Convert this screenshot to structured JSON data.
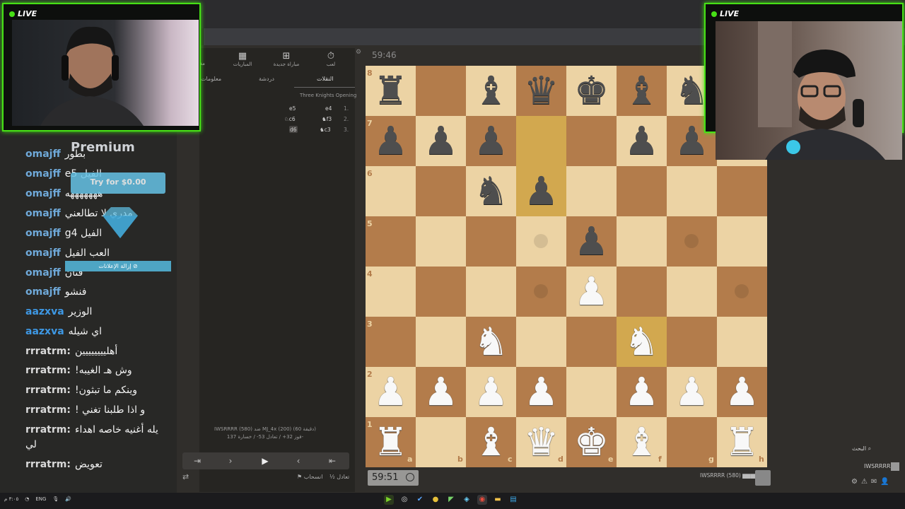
{
  "overlay": {
    "live_label": "LIVE",
    "premium_title": "Premium",
    "try_button": "Try for $0.00",
    "remove_ads": "إزالة الإعلانات ⊘"
  },
  "chat": [
    {
      "user": "omajff",
      "msg": "بطور",
      "color": "#6fa9d9"
    },
    {
      "user": "omajff",
      "msg": "e5 الفيل",
      "color": "#6fa9d9"
    },
    {
      "user": "omajff",
      "msg": "هههههههه",
      "color": "#6fa9d9"
    },
    {
      "user": "omajff",
      "msg": "مدري لا تطالعني",
      "color": "#6fa9d9"
    },
    {
      "user": "omajff",
      "msg": "g4 الفيل",
      "color": "#6fa9d9"
    },
    {
      "user": "omajff",
      "msg": "العب الفيل",
      "color": "#6fa9d9"
    },
    {
      "user": "omajff",
      "msg": "فنان",
      "color": "#6fa9d9"
    },
    {
      "user": "omajff",
      "msg": "فنشو",
      "color": "#6fa9d9"
    },
    {
      "user": "aazxva",
      "msg": "الوزير",
      "color": "#3e98e4"
    },
    {
      "user": "aazxva",
      "msg": "اي شيله",
      "color": "#3e98e4"
    },
    {
      "user": "rrratrm:",
      "msg": "أهليييييييين",
      "color": "#d9d9d9"
    },
    {
      "user": "rrratrm:",
      "msg": "!وش هـ الغيبه",
      "color": "#d9d9d9"
    },
    {
      "user": "rrratrm:",
      "msg": "!وينكم ما تبثون",
      "color": "#d9d9d9"
    },
    {
      "user": "rrratrm:",
      "msg": "! و اذا طلبنا تغني",
      "color": "#d9d9d9"
    },
    {
      "user": "rrratrm:",
      "msg": "يله أغنيه خاصه اهداء",
      "color": "#d9d9d9"
    },
    {
      "user": "",
      "msg": "لي",
      "color": "#d9d9d9"
    },
    {
      "user": "rrratrm:",
      "msg": "تعويض",
      "color": "#d9d9d9"
    }
  ],
  "panel": {
    "tabs": [
      "لعب",
      "مباراة جديدة",
      "المباريات",
      "مغلوب"
    ],
    "subtabs": [
      "النقلات",
      "دردشة",
      "معلومات"
    ],
    "opening": "Three Knights Opening",
    "moves": [
      {
        "n": "1.",
        "w": "e4",
        "b": "e5"
      },
      {
        "n": "2.",
        "w": "♞f3",
        "b": "♘c6"
      },
      {
        "n": "3.",
        "w": "♞c3",
        "b": "d6"
      }
    ],
    "player_info_1": "IWSRRRR (580) ضد MJ_4x (200) (60 دقيقة)",
    "player_info_2": "فوز 32+ / تعادل 53- / خسارة 137-",
    "draw_label": "½ تعادل",
    "resign_label": "⚑ انسحاب"
  },
  "board": {
    "time_top": "59:46",
    "clock": "59:51",
    "opponent": "IWSRRRR (580) ▆▆▆▆",
    "ranks": [
      "8",
      "7",
      "6",
      "5",
      "4",
      "3",
      "2",
      "1"
    ],
    "files": [
      "a",
      "b",
      "c",
      "d",
      "e",
      "f",
      "g",
      "h"
    ]
  },
  "right": {
    "search": "البحث",
    "user": "IWSRRRR"
  },
  "taskbar": {
    "time": "٣:٠٥ م",
    "date": "٢٠٢٤/٠٩/٠٥",
    "lang": "ENG"
  },
  "colors": {
    "accent_green": "#47e016",
    "board_light": "#ecd3a4",
    "board_dark": "#b37c4b"
  }
}
